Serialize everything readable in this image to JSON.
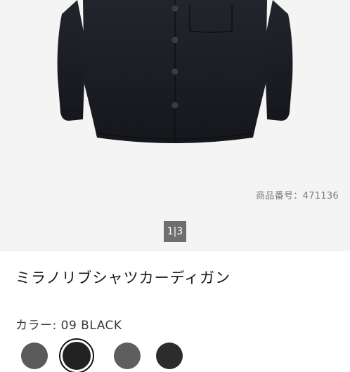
{
  "gallery": {
    "product_code": "商品番号：471136",
    "page_indicator": "1|3"
  },
  "product": {
    "title": "ミラノリブシャツカーディガン",
    "color_label": "カラー: 09 BLACK"
  },
  "colors": {
    "garment": "#1a1c22",
    "background": "#f4f4f4",
    "indicator_bg": "#6e6e6e"
  },
  "swatches": [
    {
      "name": "gray",
      "color": "#5a5a5a",
      "selected": false
    },
    {
      "name": "black",
      "color": "#222222",
      "selected": true
    },
    {
      "name": "dark-gray",
      "color": "#5e5e5e",
      "selected": false
    },
    {
      "name": "charcoal",
      "color": "#2c2c2c",
      "selected": false
    }
  ]
}
